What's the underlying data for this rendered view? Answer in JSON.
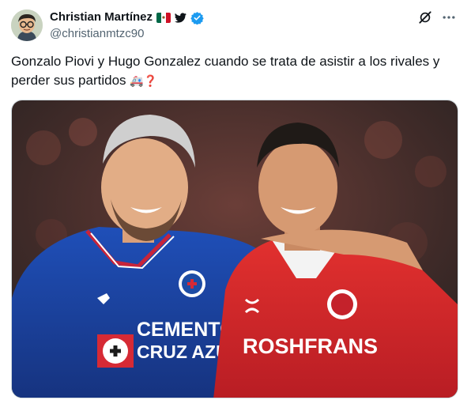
{
  "author": {
    "name": "Christian Martínez",
    "handle": "@christianmtzc90",
    "verified": true,
    "badges": [
      "mexico-flag-icon",
      "bird-icon",
      "verified-check-icon"
    ]
  },
  "tweet": {
    "text": "Gonzalo Piovi y Hugo Gonzalez cuando se trata de asistir a los rivales y perder sus partidos",
    "emoji": "🚑❓"
  },
  "media": {
    "left_jersey": {
      "sponsor_line1": "CEMENTO",
      "sponsor_line2": "CRUZ AZUL",
      "color": "#1a3f9a"
    },
    "right_jersey": {
      "sponsor": "ROSHFRANS",
      "color": "#d6252b"
    }
  },
  "colors": {
    "verified": "#1d9bf0",
    "text": "#0f1419",
    "muted": "#536471"
  }
}
